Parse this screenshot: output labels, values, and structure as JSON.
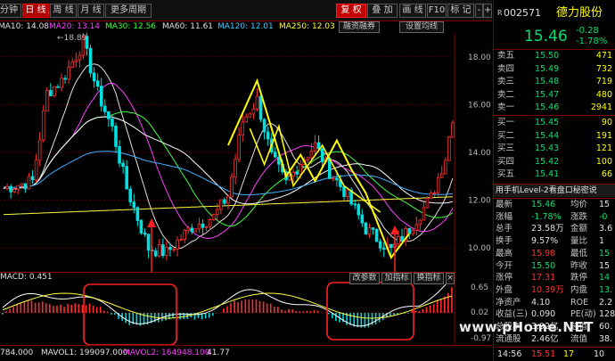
{
  "toolbar": {
    "tabs": [
      {
        "label": "分钟",
        "active": false
      },
      {
        "label": "日 线",
        "active": true
      },
      {
        "label": "周 线",
        "active": false
      },
      {
        "label": "月 线",
        "active": false
      },
      {
        "label": "更多周期",
        "active": false
      }
    ],
    "right_buttons": [
      {
        "label": "复 权",
        "style": "red"
      },
      {
        "label": "叠 加",
        "style": "normal"
      },
      {
        "label": "画 线",
        "style": "normal"
      },
      {
        "label": "F10",
        "style": "normal"
      },
      {
        "label": "标 记",
        "style": "normal"
      },
      {
        "label": "-",
        "style": "normal"
      },
      {
        "label": "+",
        "style": "normal"
      }
    ],
    "sub_buttons": [
      "融资融券",
      "设置均线"
    ]
  },
  "ma_legend": [
    {
      "label": "MA10: 14.08",
      "color": "#e0e0e0"
    },
    {
      "label": "MA20: 13.14",
      "color": "#ff40ff"
    },
    {
      "label": "MA30: 12.56",
      "color": "#40ff40"
    },
    {
      "label": "MA60: 11.61",
      "color": "#e0e0e0"
    },
    {
      "label": "MA120: 12.01",
      "color": "#40d0ff"
    },
    {
      "label": "MA250: 12.03",
      "color": "#ffff40"
    }
  ],
  "price_axis": {
    "ticks": [
      "18.00",
      "16.00",
      "14.00",
      "12.00",
      "10.00"
    ],
    "ymin": 9.0,
    "ymax": 19.0,
    "high_label": "18.89"
  },
  "macd_axis": {
    "ticks": [
      "0.65",
      "0.02",
      "-0.97"
    ]
  },
  "macd_legend": {
    "label": "MACD: 0.451",
    "buttons": [
      "改参数",
      "加指标",
      "换指标"
    ]
  },
  "bottom_bar": {
    "vol": "784.000",
    "mavol1": "MAVOL1: 199097.000",
    "mavol2": "MAVOL2: 164948.100",
    "extra": "41.77"
  },
  "stock": {
    "code": "002571",
    "prefix": "R",
    "name": "德力股份",
    "price": "15.46",
    "change": "-0.28",
    "change_pct": "-1.78%"
  },
  "order_book": {
    "asks": [
      {
        "label": "卖五",
        "price": "15.50",
        "vol": "471"
      },
      {
        "label": "卖四",
        "price": "15.49",
        "vol": "732"
      },
      {
        "label": "卖三",
        "price": "15.48",
        "vol": "719"
      },
      {
        "label": "卖二",
        "price": "15.47",
        "vol": "480"
      },
      {
        "label": "卖一",
        "price": "15.46",
        "vol": "2941"
      }
    ],
    "bids": [
      {
        "label": "买一",
        "price": "15.45",
        "vol": "90"
      },
      {
        "label": "买二",
        "price": "15.44",
        "vol": "191"
      },
      {
        "label": "买三",
        "price": "15.43",
        "vol": "121"
      },
      {
        "label": "买四",
        "price": "15.42",
        "vol": "100"
      },
      {
        "label": "买五",
        "price": "15.41",
        "vol": "66"
      }
    ]
  },
  "level2_banner": "用手机Level-2看盘口秘密说",
  "stats": [
    {
      "l1": "最新",
      "v1": "15.46",
      "c1": "green",
      "l2": "均价",
      "v2": "15",
      "c2": "white"
    },
    {
      "l1": "涨幅",
      "v1": "-1.78%",
      "c1": "green",
      "l2": "涨跌",
      "v2": "-0",
      "c2": "green"
    },
    {
      "l1": "总手",
      "v1": "23.58万",
      "c1": "white",
      "l2": "金额",
      "v2": "3.6",
      "c2": "white"
    },
    {
      "l1": "换手",
      "v1": "9.57%",
      "c1": "white",
      "l2": "量比",
      "v2": "1",
      "c2": "white"
    },
    {
      "l1": "最高",
      "v1": "15.98",
      "c1": "red",
      "l2": "最低",
      "v2": "15",
      "c2": "green"
    },
    {
      "l1": "今开",
      "v1": "15.50",
      "c1": "green",
      "l2": "昨收",
      "v2": "15",
      "c2": "white"
    },
    {
      "l1": "涨停",
      "v1": "17.31",
      "c1": "red",
      "l2": "跌停",
      "v2": "14",
      "c2": "green"
    },
    {
      "l1": "外盘",
      "v1": "10.39万",
      "c1": "red",
      "l2": "内盘",
      "v2": "13.",
      "c2": "green"
    },
    {
      "l1": "净资产",
      "v1": "4.10",
      "c1": "white",
      "l2": "ROE",
      "v2": "2.2",
      "c2": "white"
    },
    {
      "l1": "收益(三)",
      "v1": "0.090",
      "c1": "white",
      "l2": "PE(动)",
      "v2": "128",
      "c2": "white"
    },
    {
      "l1": "总股本",
      "v1": "3.92亿",
      "c1": "white",
      "l2": "总值",
      "v2": "60.",
      "c2": "white"
    },
    {
      "l1": "流通股",
      "v1": "2.46亿",
      "c1": "white",
      "l2": "流值",
      "v2": "38.",
      "c2": "white"
    }
  ],
  "tick": {
    "time": "14:56",
    "price": "15.51",
    "vol": "17",
    "num": "10"
  },
  "watermark": "www.pHome.NET"
}
